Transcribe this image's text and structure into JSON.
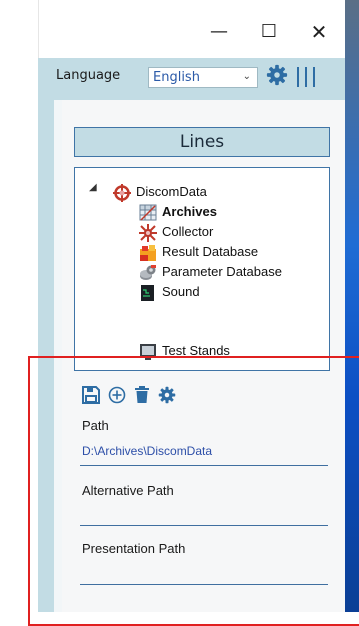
{
  "window": {
    "minimize_glyph": "—",
    "maximize_glyph": "☐",
    "close_glyph": "✕"
  },
  "toolbar": {
    "language_label": "Language",
    "language_value": "English",
    "settings_icon": "gear-icon",
    "menu_icon": "vertical-bars-icon"
  },
  "panel": {
    "header": "Lines",
    "tree": {
      "root": "DiscomData",
      "children": [
        "Archives",
        "Collector",
        "Result Database",
        "Parameter Database",
        "Sound",
        "Test Stands"
      ],
      "selected": "Archives"
    },
    "actions": [
      "save-icon",
      "add-circle-icon",
      "delete-icon",
      "gear-icon"
    ],
    "fields": {
      "path_label": "Path",
      "path_value": "D:\\Archives\\DiscomData",
      "alt_path_label": "Alternative Path",
      "alt_path_value": "",
      "presentation_path_label": "Presentation Path",
      "presentation_path_value": ""
    }
  },
  "colors": {
    "accent": "#3f74a6",
    "toolbar_bg": "#c2dce4",
    "icon_blue": "#2e6da4",
    "highlight_box": "#e02020"
  }
}
